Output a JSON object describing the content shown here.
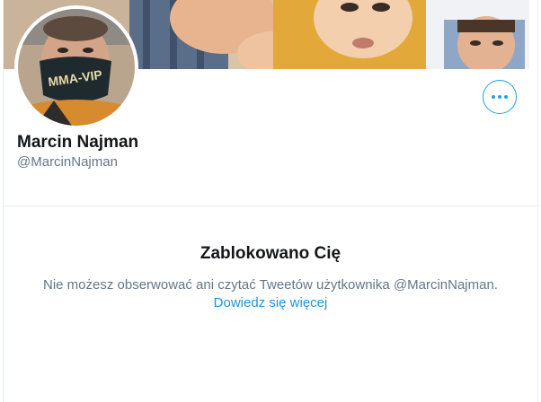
{
  "profile": {
    "name": "Marcin Najman",
    "handle": "@MarcinNajman",
    "mask_text": "MMA-VIP"
  },
  "actions": {
    "more_icon": "more-horizontal-icon"
  },
  "blocked": {
    "title": "Zablokowano Cię",
    "description": "Nie możesz obserwować ani czytać Tweetów użytkownika @MarcinNajman.",
    "link": "Dowiedz się więcej"
  },
  "colors": {
    "accent": "#1da1f2",
    "link": "#1b95e0",
    "text_primary": "#14171a",
    "text_secondary": "#657786",
    "border": "#e6ecf0"
  }
}
